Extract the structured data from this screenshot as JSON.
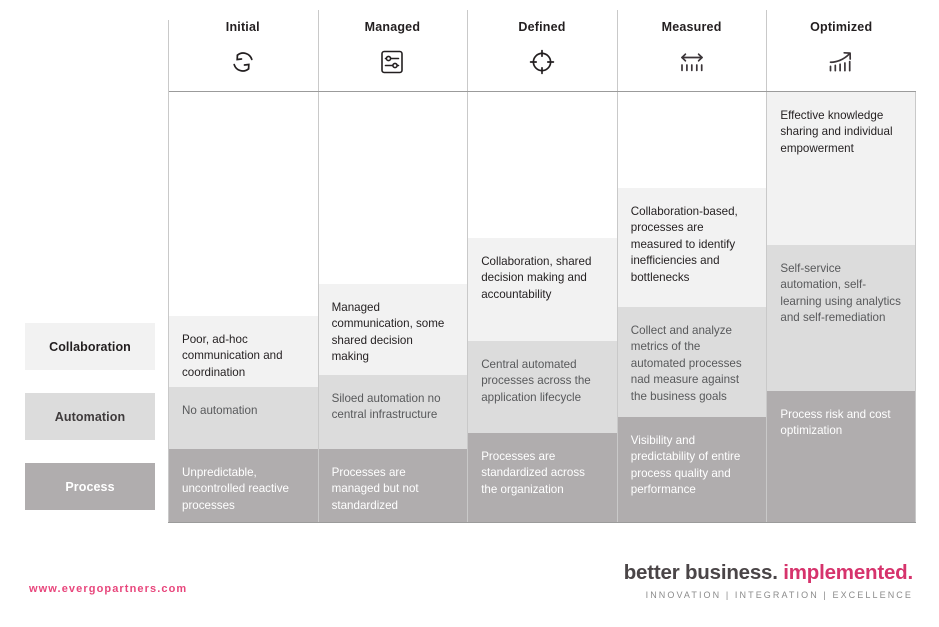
{
  "legend": {
    "items": [
      {
        "label": "Collaboration",
        "tier": "t-collab",
        "color": "#f2f2f2"
      },
      {
        "label": "Automation",
        "tier": "t-auto",
        "color": "#dcdcdc"
      },
      {
        "label": "Process",
        "tier": "t-process",
        "color": "#b0adae"
      }
    ]
  },
  "matrix": {
    "columns": [
      {
        "label": "Initial",
        "icon": "refresh-cycle-icon"
      },
      {
        "label": "Managed",
        "icon": "settings-sliders-icon"
      },
      {
        "label": "Defined",
        "icon": "target-crosshair-icon"
      },
      {
        "label": "Measured",
        "icon": "measure-ruler-icon"
      },
      {
        "label": "Optimized",
        "icon": "growth-chart-arrow-icon"
      }
    ],
    "cells": {
      "initial": {
        "collaboration": "Poor, ad-hoc communication and coordination",
        "automation": "No automation",
        "process": "Unpredictable, uncontrolled reactive processes"
      },
      "managed": {
        "collaboration": "Managed communication, some shared decision making",
        "automation": "Siloed automation no central infrastructure",
        "process": "Processes are managed but not standardized"
      },
      "defined": {
        "collaboration": "Collaboration, shared decision making and accountability",
        "automation": "Central automated processes across the application lifecycle",
        "process": "Processes are standardized across the organization"
      },
      "measured": {
        "collaboration": "Collaboration-based, processes are measured to identify inefficiencies and bottlenecks",
        "automation": "Collect and analyze metrics of the automated processes nad measure against the business goals",
        "process": "Visibility and predictability of entire process quality and performance"
      },
      "optimized": {
        "collaboration": "Effective knowledge sharing and individual empowerment",
        "automation": "Self-service automation, self-learning using analytics and self-remediation",
        "process": "Process risk and cost optimization"
      }
    }
  },
  "footer": {
    "url": "www.evergopartners.com",
    "tagline_dark": "better business.",
    "tagline_accent": " implemented.",
    "subtagline": "INNOVATION | INTEGRATION | EXCELLENCE",
    "accent_color": "#d6336c",
    "url_color": "#e8467c"
  }
}
